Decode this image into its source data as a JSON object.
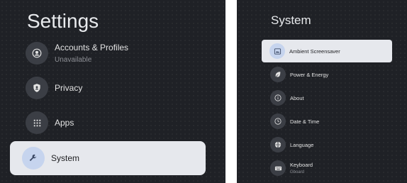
{
  "left": {
    "title": "Settings",
    "items": [
      {
        "label": "Accounts & Profiles",
        "sub": "Unavailable",
        "icon": "account-icon"
      },
      {
        "label": "Privacy",
        "icon": "shield-icon"
      },
      {
        "label": "Apps",
        "icon": "apps-grid-icon"
      },
      {
        "label": "System",
        "icon": "wrench-icon",
        "selected": true
      }
    ]
  },
  "right": {
    "title": "System",
    "items": [
      {
        "label": "Ambient Screensaver",
        "icon": "screensaver-icon",
        "selected": true
      },
      {
        "label": "Power & Energy",
        "icon": "leaf-icon"
      },
      {
        "label": "About",
        "icon": "info-icon"
      },
      {
        "label": "Date & Time",
        "icon": "clock-icon"
      },
      {
        "label": "Language",
        "icon": "globe-icon"
      },
      {
        "label": "Keyboard",
        "sub": "Gboard",
        "icon": "keyboard-icon"
      }
    ]
  },
  "colors": {
    "background": "#1f2126",
    "selected_bg": "#e6e8ed",
    "icon_circle": "#3b3e45",
    "icon_circle_selected": "#c6d4ee"
  }
}
